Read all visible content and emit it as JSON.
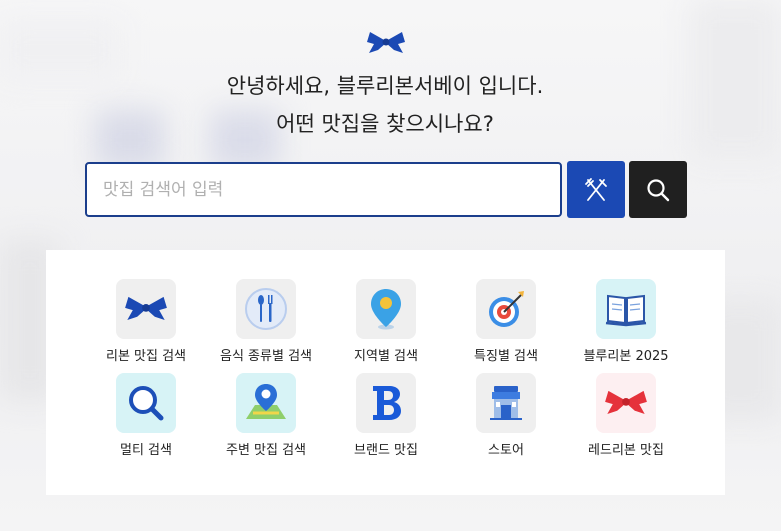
{
  "greeting": {
    "line1": "안녕하세요, 블루리본서베이 입니다.",
    "line2": "어떤 맛집을 찾으시나요?"
  },
  "search": {
    "placeholder": "맛집 검색어 입력",
    "value": ""
  },
  "icons": {
    "logo": "blue-ribbon-icon",
    "food_button": "fork-knife-icon",
    "search_button": "search-icon"
  },
  "colors": {
    "brand_blue": "#1b49b4",
    "input_border": "#1b3e8c",
    "dark_button": "#202020",
    "red_ribbon": "#e5323b"
  },
  "menu": {
    "items": [
      {
        "label": "리본 맛집 검색",
        "icon": "blue-ribbon-icon"
      },
      {
        "label": "음식 종류별 검색",
        "icon": "spoon-fork-plate-icon"
      },
      {
        "label": "지역별 검색",
        "icon": "map-pin-icon"
      },
      {
        "label": "특징별 검색",
        "icon": "target-arrow-icon"
      },
      {
        "label": "블루리본 2025",
        "icon": "open-book-icon"
      },
      {
        "label": "멀티 검색",
        "icon": "magnifier-icon"
      },
      {
        "label": "주변 맛집 검색",
        "icon": "map-location-icon"
      },
      {
        "label": "브랜드 맛집",
        "icon": "brand-b-icon"
      },
      {
        "label": "스토어",
        "icon": "store-icon"
      },
      {
        "label": "레드리본 맛집",
        "icon": "red-ribbon-icon"
      }
    ]
  }
}
